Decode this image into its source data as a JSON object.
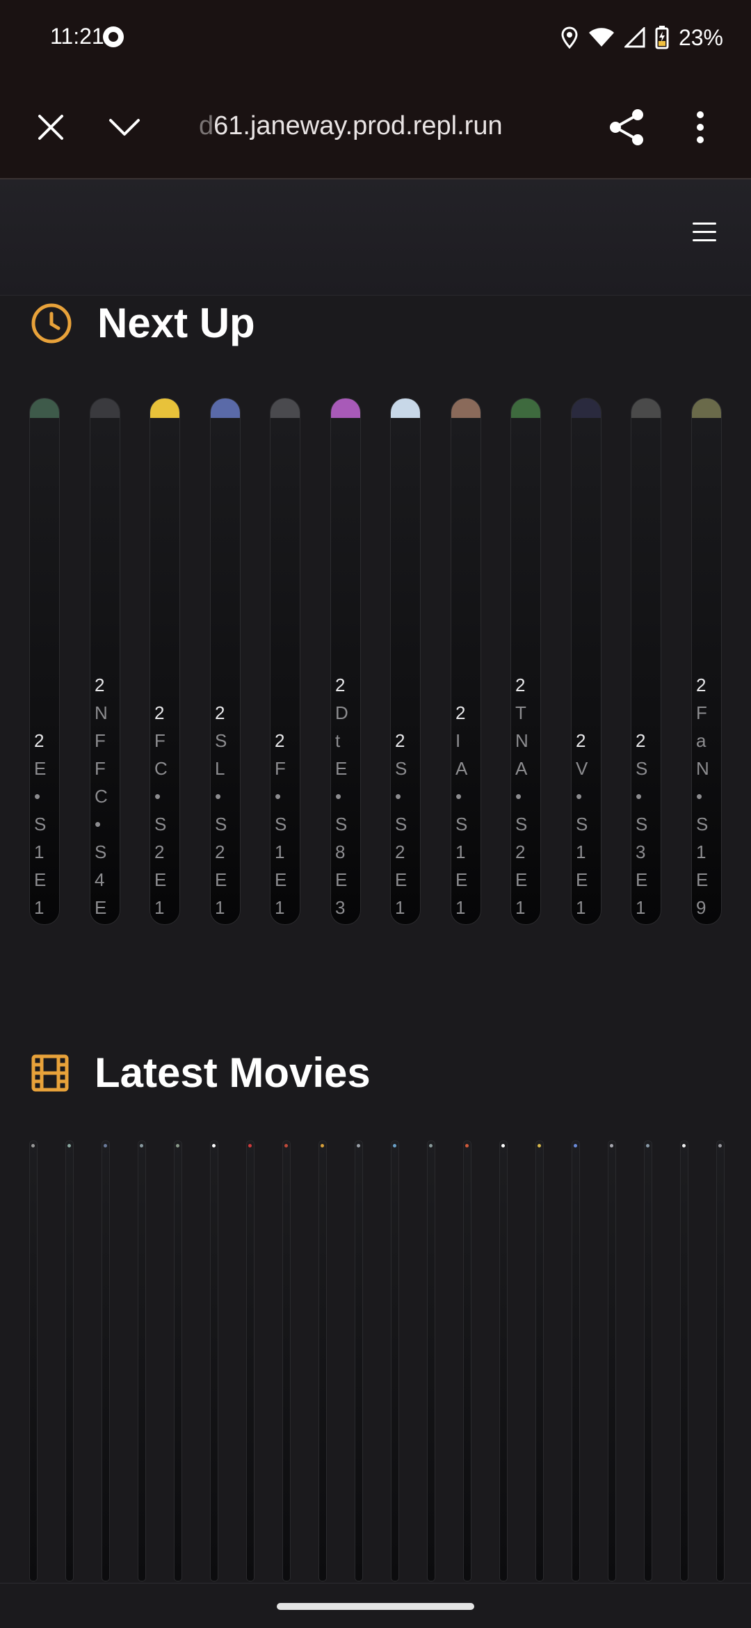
{
  "status": {
    "time": "11:21",
    "battery": "23%"
  },
  "toolbar": {
    "url_faded": "d",
    "url_main": "61.janeway.prod.repl.run",
    "close_icon": "close-icon",
    "collapse_icon": "chevron-down-icon",
    "share_icon": "share-icon",
    "menu_icon": "more-vert-icon"
  },
  "header": {
    "menu_icon": "hamburger-icon"
  },
  "next_up": {
    "title": "Next Up",
    "icon": "clock-icon",
    "accent": "#e8a23a",
    "cards": [
      {
        "thumb_color": "#3e5a4a",
        "lines": [
          "2",
          "E",
          "•",
          "S",
          "1",
          "E",
          "1"
        ]
      },
      {
        "thumb_color": "#3a3a3e",
        "lines": [
          "2",
          "N",
          "F",
          "F",
          "C",
          "•",
          "S",
          "4",
          "E"
        ]
      },
      {
        "thumb_color": "#e8c23a",
        "lines": [
          "2",
          "F",
          "C",
          "•",
          "S",
          "2",
          "E",
          "1"
        ]
      },
      {
        "thumb_color": "#5a6aa8",
        "lines": [
          "2",
          "S",
          "L",
          "•",
          "S",
          "2",
          "E",
          "1"
        ]
      },
      {
        "thumb_color": "#4a4a4e",
        "lines": [
          "2",
          "F",
          "•",
          "S",
          "1",
          "E",
          "1"
        ]
      },
      {
        "thumb_color": "#a85ab8",
        "lines": [
          "2",
          "D",
          "t",
          "E",
          "•",
          "S",
          "8",
          "E",
          "3"
        ]
      },
      {
        "thumb_color": "#c8d8e8",
        "lines": [
          "2",
          "S",
          "•",
          "S",
          "2",
          "E",
          "1"
        ]
      },
      {
        "thumb_color": "#8a6a5a",
        "lines": [
          "2",
          "I",
          "A",
          "•",
          "S",
          "1",
          "E",
          "1"
        ]
      },
      {
        "thumb_color": "#3e6a3e",
        "lines": [
          "2",
          "T",
          "N",
          "A",
          "•",
          "S",
          "2",
          "E",
          "1"
        ]
      },
      {
        "thumb_color": "#2a2a3e",
        "lines": [
          "2",
          "V",
          "•",
          "S",
          "1",
          "E",
          "1"
        ]
      },
      {
        "thumb_color": "#4a4a4a",
        "lines": [
          "2",
          "S",
          "•",
          "S",
          "3",
          "E",
          "1"
        ]
      },
      {
        "thumb_color": "#6a6a4a",
        "lines": [
          "2",
          "F",
          "a",
          "N",
          "•",
          "S",
          "1",
          "E",
          "9"
        ]
      }
    ]
  },
  "latest_movies": {
    "title": "Latest Movies",
    "icon": "film-icon",
    "accent": "#e8a23a",
    "columns": [
      "#9a9a9a",
      "#8aa8a0",
      "#6a7a9a",
      "#8a9aa0",
      "#8a9a8a",
      "#ffffff",
      "#d03a3a",
      "#c04a3a",
      "#d8a03a",
      "#9aa0a8",
      "#6aa0c8",
      "#8a9a9a",
      "#d05a3a",
      "#ffffff",
      "#d8b84a",
      "#6a8ad8",
      "#a8a8b0",
      "#8a9aa8",
      "#f0f0f0",
      "#9a9aa0"
    ]
  }
}
